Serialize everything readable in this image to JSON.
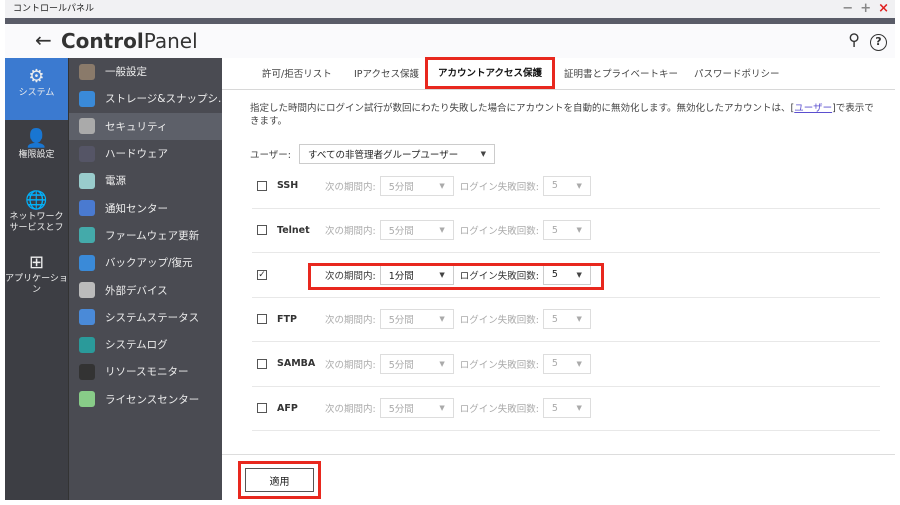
{
  "window": {
    "title": "コントロールパネル",
    "controls": [
      "−",
      "+",
      "×"
    ]
  },
  "header": {
    "back": "←",
    "title_bold": "Control",
    "title_rest": "Panel",
    "search": "⚲",
    "help": "?"
  },
  "rail": [
    {
      "label": "システム",
      "icon": "⚙"
    },
    {
      "label": "権限設定",
      "icon": "👤"
    },
    {
      "label": "ネットワーク サービスとフ",
      "icon": "🌐"
    },
    {
      "label": "アプリケーション",
      "icon": "⊞"
    }
  ],
  "menu": [
    {
      "label": "一般設定",
      "color": "#8a7a6a"
    },
    {
      "label": "ストレージ&スナップシ...",
      "color": "#3a8ad8"
    },
    {
      "label": "セキュリティ",
      "color": "#aaa"
    },
    {
      "label": "ハードウェア",
      "color": "#556"
    },
    {
      "label": "電源",
      "color": "#9cc"
    },
    {
      "label": "通知センター",
      "color": "#4a7ad0"
    },
    {
      "label": "ファームウェア更新",
      "color": "#4aa"
    },
    {
      "label": "バックアップ/復元",
      "color": "#3a8ad8"
    },
    {
      "label": "外部デバイス",
      "color": "#bbb"
    },
    {
      "label": "システムステータス",
      "color": "#4a8ad8"
    },
    {
      "label": "システムログ",
      "color": "#2a9a9a"
    },
    {
      "label": "リソースモニター",
      "color": "#333"
    },
    {
      "label": "ライセンスセンター",
      "color": "#8c8"
    }
  ],
  "tabs": [
    "許可/拒否リスト",
    "IPアクセス保護",
    "アカウントアクセス保護",
    "証明書とプライベートキー",
    "パスワードポリシー"
  ],
  "description": {
    "text": "指定した時間内にログイン試行が数回にわたり失敗した場合にアカウントを自動的に無効化します。無効化したアカウントは、[",
    "link": "ユーザー",
    "text_end": "]で表示できます。"
  },
  "user_filter": {
    "label": "ユーザー:",
    "value": "すべての非管理者グループユーザー"
  },
  "period_label": "次の期間内:",
  "fail_label": "ログイン失敗回数:",
  "rows": [
    {
      "name": "SSH",
      "checked": false,
      "period": "5分間",
      "count": "5"
    },
    {
      "name": "Telnet",
      "checked": false,
      "period": "5分間",
      "count": "5"
    },
    {
      "name": "",
      "checked": true,
      "period": "1分間",
      "count": "5"
    },
    {
      "name": "FTP",
      "checked": false,
      "period": "5分間",
      "count": "5"
    },
    {
      "name": "SAMBA",
      "checked": false,
      "period": "5分間",
      "count": "5"
    },
    {
      "name": "AFP",
      "checked": false,
      "period": "5分間",
      "count": "5"
    }
  ],
  "apply": "適用"
}
